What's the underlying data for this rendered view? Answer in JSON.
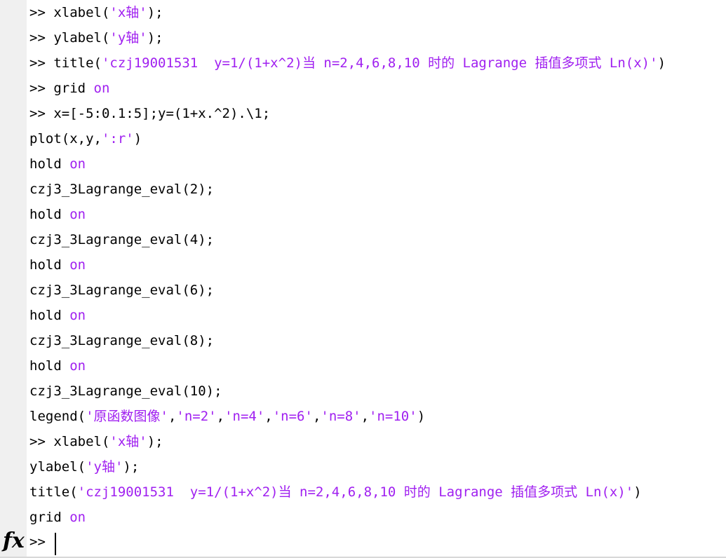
{
  "prompt": ">>",
  "lines": [
    {
      "prompt": ">> ",
      "segments": [
        {
          "t": "xlabel(",
          "c": "code"
        },
        {
          "t": "'x轴'",
          "c": "str"
        },
        {
          "t": ");",
          "c": "code"
        }
      ]
    },
    {
      "prompt": ">> ",
      "segments": [
        {
          "t": "ylabel(",
          "c": "code"
        },
        {
          "t": "'y轴'",
          "c": "str"
        },
        {
          "t": ");",
          "c": "code"
        }
      ]
    },
    {
      "prompt": ">> ",
      "segments": [
        {
          "t": "title(",
          "c": "code"
        },
        {
          "t": "'czj19001531  y=1/(1+x^2)当 n=2,4,6,8,10 时的 Lagrange 插值多项式 Ln(x)'",
          "c": "str"
        },
        {
          "t": ")",
          "c": "code"
        }
      ]
    },
    {
      "prompt": ">> ",
      "segments": [
        {
          "t": "grid ",
          "c": "code"
        },
        {
          "t": "on",
          "c": "kw"
        }
      ]
    },
    {
      "prompt": ">> ",
      "segments": [
        {
          "t": "x=[-5:0.1:5];y=(1+x.^2).\\1;",
          "c": "code"
        }
      ]
    },
    {
      "prompt": "",
      "segments": [
        {
          "t": "plot(x,y,",
          "c": "code"
        },
        {
          "t": "':r'",
          "c": "str"
        },
        {
          "t": ")",
          "c": "code"
        }
      ]
    },
    {
      "prompt": "",
      "segments": [
        {
          "t": "hold ",
          "c": "code"
        },
        {
          "t": "on",
          "c": "kw"
        }
      ]
    },
    {
      "prompt": "",
      "segments": [
        {
          "t": "czj3_3Lagrange_eval(2);",
          "c": "code"
        }
      ]
    },
    {
      "prompt": "",
      "segments": [
        {
          "t": "hold ",
          "c": "code"
        },
        {
          "t": "on",
          "c": "kw"
        }
      ]
    },
    {
      "prompt": "",
      "segments": [
        {
          "t": "czj3_3Lagrange_eval(4);",
          "c": "code"
        }
      ]
    },
    {
      "prompt": "",
      "segments": [
        {
          "t": "hold ",
          "c": "code"
        },
        {
          "t": "on",
          "c": "kw"
        }
      ]
    },
    {
      "prompt": "",
      "segments": [
        {
          "t": "czj3_3Lagrange_eval(6);",
          "c": "code"
        }
      ]
    },
    {
      "prompt": "",
      "segments": [
        {
          "t": "hold ",
          "c": "code"
        },
        {
          "t": "on",
          "c": "kw"
        }
      ]
    },
    {
      "prompt": "",
      "segments": [
        {
          "t": "czj3_3Lagrange_eval(8);",
          "c": "code"
        }
      ]
    },
    {
      "prompt": "",
      "segments": [
        {
          "t": "hold ",
          "c": "code"
        },
        {
          "t": "on",
          "c": "kw"
        }
      ]
    },
    {
      "prompt": "",
      "segments": [
        {
          "t": "czj3_3Lagrange_eval(10);",
          "c": "code"
        }
      ]
    },
    {
      "prompt": "",
      "segments": [
        {
          "t": "legend(",
          "c": "code"
        },
        {
          "t": "'原函数图像'",
          "c": "str"
        },
        {
          "t": ",",
          "c": "code"
        },
        {
          "t": "'n=2'",
          "c": "str"
        },
        {
          "t": ",",
          "c": "code"
        },
        {
          "t": "'n=4'",
          "c": "str"
        },
        {
          "t": ",",
          "c": "code"
        },
        {
          "t": "'n=6'",
          "c": "str"
        },
        {
          "t": ",",
          "c": "code"
        },
        {
          "t": "'n=8'",
          "c": "str"
        },
        {
          "t": ",",
          "c": "code"
        },
        {
          "t": "'n=10'",
          "c": "str"
        },
        {
          "t": ")",
          "c": "code"
        }
      ]
    },
    {
      "prompt": ">> ",
      "segments": [
        {
          "t": "xlabel(",
          "c": "code"
        },
        {
          "t": "'x轴'",
          "c": "str"
        },
        {
          "t": ");",
          "c": "code"
        }
      ]
    },
    {
      "prompt": "",
      "segments": [
        {
          "t": "ylabel(",
          "c": "code"
        },
        {
          "t": "'y轴'",
          "c": "str"
        },
        {
          "t": ");",
          "c": "code"
        }
      ]
    },
    {
      "prompt": "",
      "segments": [
        {
          "t": "title(",
          "c": "code"
        },
        {
          "t": "'czj19001531  y=1/(1+x^2)当 n=2,4,6,8,10 时的 Lagrange 插值多项式 Ln(x)'",
          "c": "str"
        },
        {
          "t": ")",
          "c": "code"
        }
      ]
    },
    {
      "prompt": "",
      "segments": [
        {
          "t": "grid ",
          "c": "code"
        },
        {
          "t": "on",
          "c": "kw"
        }
      ]
    }
  ],
  "fx_icon": "function-fx-icon",
  "colors": {
    "string": "#a020f0",
    "keyword": "#a020f0",
    "code": "#000000",
    "gutter": "#f0f0f0"
  }
}
